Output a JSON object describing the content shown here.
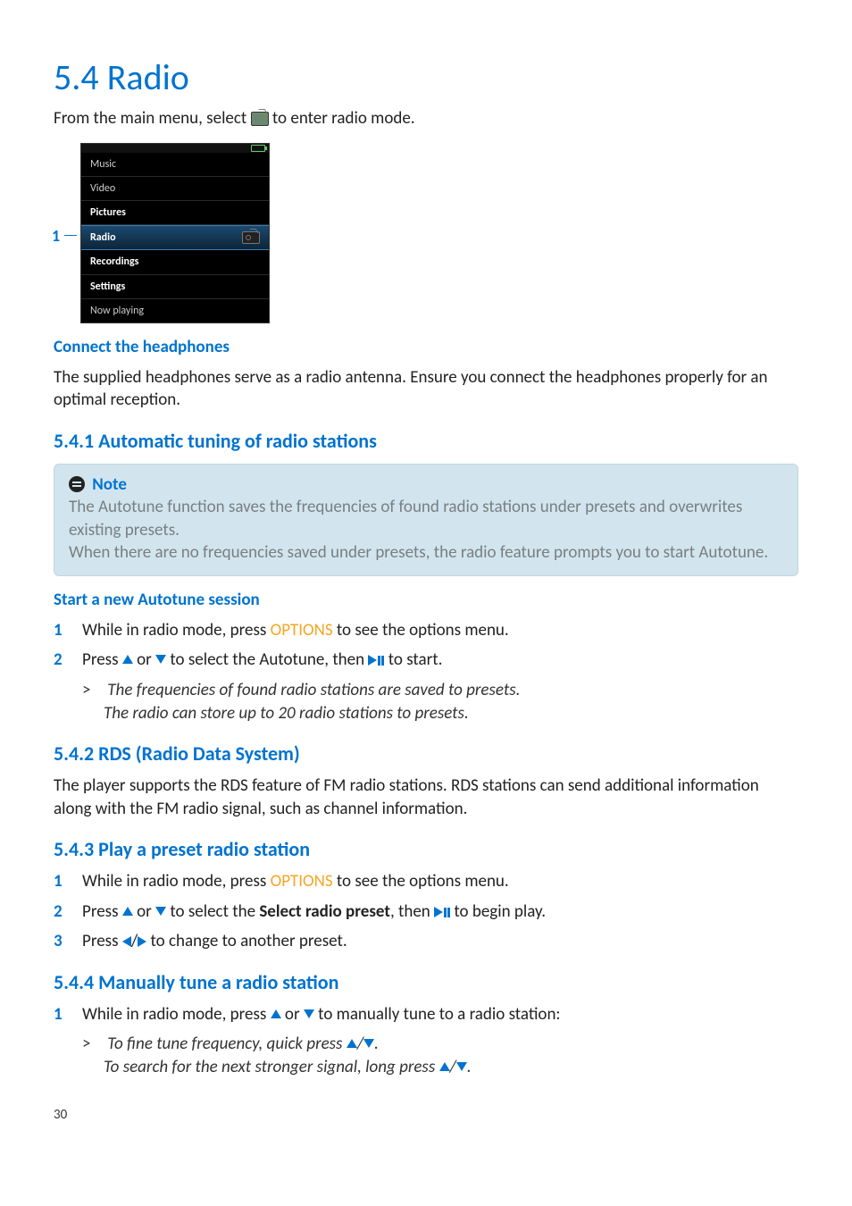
{
  "title": "5.4  Radio",
  "intro_a": "From the main menu, select ",
  "intro_b": " to enter radio mode.",
  "menu_label": "1",
  "menu": {
    "items": [
      "Music",
      "Video",
      "Pictures",
      "Radio",
      "Recordings",
      "Settings",
      "Now playing"
    ],
    "selected": "Radio"
  },
  "connect": {
    "heading": "Connect the headphones",
    "body": "The supplied headphones serve as a radio antenna. Ensure you connect the headphones properly for an optimal reception."
  },
  "s541": {
    "heading": "5.4.1 Automatic tuning of radio stations",
    "note_label": "Note",
    "note_body1": "The Autotune function saves the frequencies of found radio stations under presets and overwrites existing presets.",
    "note_body2": "When there are no frequencies saved under presets, the radio feature prompts you to start Autotune.",
    "start_heading": "Start a new Autotune session",
    "step1_a": "While in radio mode, press ",
    "options": "OPTIONS",
    "step1_b": " to see the options menu.",
    "step2_a": "Press ",
    "step2_b": " or ",
    "step2_c": " to select the Autotune, then ",
    "step2_d": " to start.",
    "result1": "The frequencies of found radio stations are saved to presets.",
    "result2": "The radio can store up to 20 radio stations to presets."
  },
  "s542": {
    "heading": "5.4.2 RDS (Radio Data System)",
    "body": "The player supports the RDS feature of FM radio stations. RDS stations can send additional information along with the FM radio signal, such as channel information."
  },
  "s543": {
    "heading": "5.4.3 Play a preset radio station",
    "step1_a": "While in radio mode, press ",
    "step1_b": " to see the options menu.",
    "step2_a": "Press ",
    "step2_b": " or ",
    "step2_c": " to select the ",
    "step2_bold": "Select radio preset",
    "step2_d": ", then ",
    "step2_e": " to begin play.",
    "step3_a": "Press ",
    "step3_b": " to change to another preset."
  },
  "s544": {
    "heading": "5.4.4 Manually tune a radio station",
    "step1_a": "While in radio mode, press ",
    "step1_b": " or ",
    "step1_c": " to manually tune to a radio station:",
    "result1_a": "To fine tune frequency, quick press ",
    "result1_b": ".",
    "result2_a": "To search for the next stronger signal, long press ",
    "result2_b": "."
  },
  "page": "30"
}
